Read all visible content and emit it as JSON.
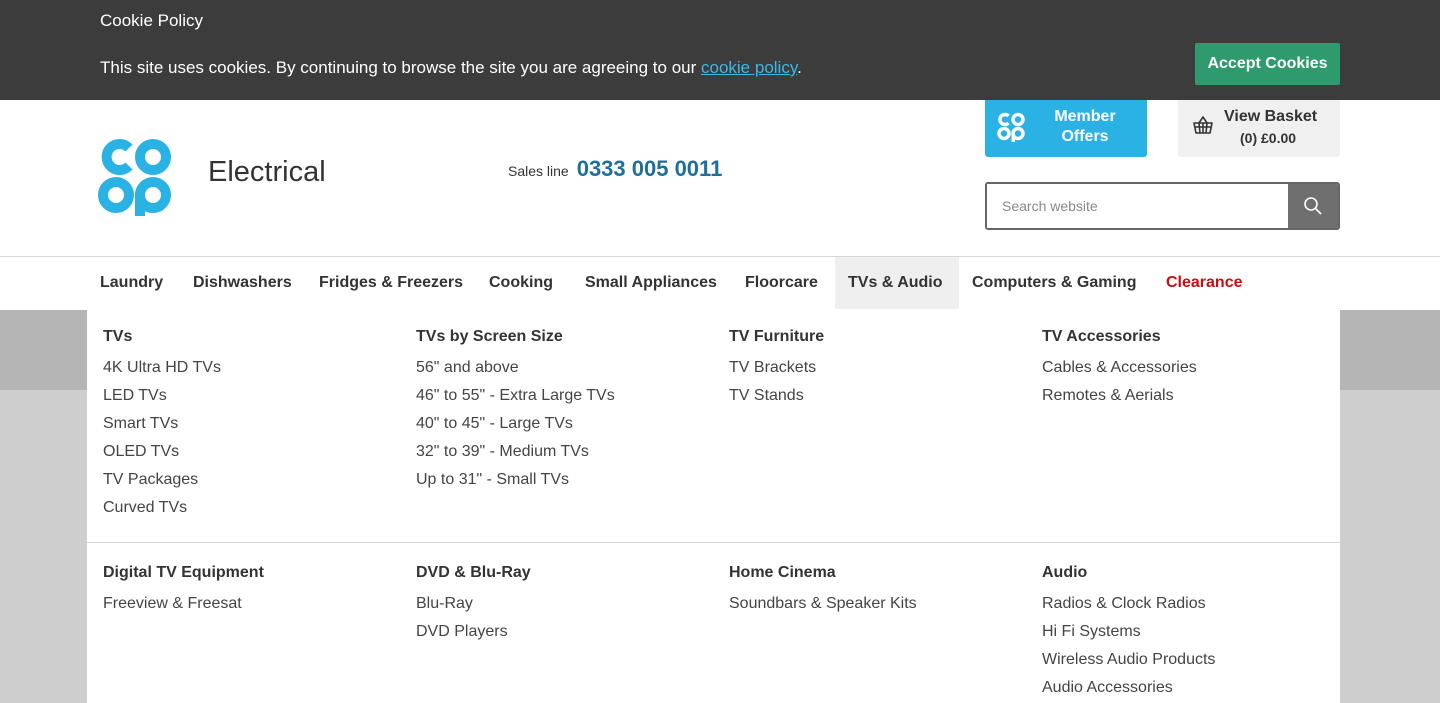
{
  "cookie": {
    "title": "Cookie Policy",
    "text_before": "This site uses cookies. By continuing to browse the site you are agreeing to our ",
    "link": "cookie policy",
    "text_after": ".",
    "accept": "Accept Cookies"
  },
  "header": {
    "brand": "Electrical",
    "sales_label": "Sales line",
    "sales_number": "0333 005 0011",
    "member_offers": "Member Offers",
    "basket_title": "View Basket",
    "basket_summary": "(0) £0.00",
    "search_placeholder": "Search website"
  },
  "nav": [
    {
      "label": "Laundry"
    },
    {
      "label": "Dishwashers"
    },
    {
      "label": "Fridges & Freezers"
    },
    {
      "label": "Cooking"
    },
    {
      "label": "Small Appliances"
    },
    {
      "label": "Floorcare"
    },
    {
      "label": "TVs & Audio"
    },
    {
      "label": "Computers & Gaming"
    },
    {
      "label": "Clearance"
    }
  ],
  "menu": [
    {
      "title": "TVs",
      "links": [
        "4K Ultra HD TVs",
        "LED TVs",
        "Smart TVs",
        "OLED TVs",
        "TV Packages",
        "Curved TVs"
      ]
    },
    {
      "title": "TVs by Screen Size",
      "links": [
        "56\" and above",
        "46\" to 55\" - Extra Large TVs",
        "40\" to 45\" - Large TVs",
        "32\" to 39\" - Medium TVs",
        "Up to 31\" - Small TVs"
      ]
    },
    {
      "title": "TV Furniture",
      "links": [
        "TV Brackets",
        "TV Stands"
      ]
    },
    {
      "title": "TV Accessories",
      "links": [
        "Cables & Accessories",
        "Remotes & Aerials"
      ]
    },
    {
      "title": "Digital TV Equipment",
      "links": [
        "Freeview & Freesat"
      ]
    },
    {
      "title": "DVD & Blu-Ray",
      "links": [
        "Blu-Ray",
        "DVD Players"
      ]
    },
    {
      "title": "Home Cinema",
      "links": [
        "Soundbars & Speaker Kits"
      ]
    },
    {
      "title": "Audio",
      "links": [
        "Radios & Clock Radios",
        "Hi Fi Systems",
        "Wireless Audio Products",
        "Audio Accessories"
      ]
    }
  ],
  "colors": {
    "brand_blue": "#2bb2e4",
    "accept_green": "#2e9a6e",
    "clearance_red": "#c60e13",
    "phone_blue": "#1f6f9a"
  }
}
